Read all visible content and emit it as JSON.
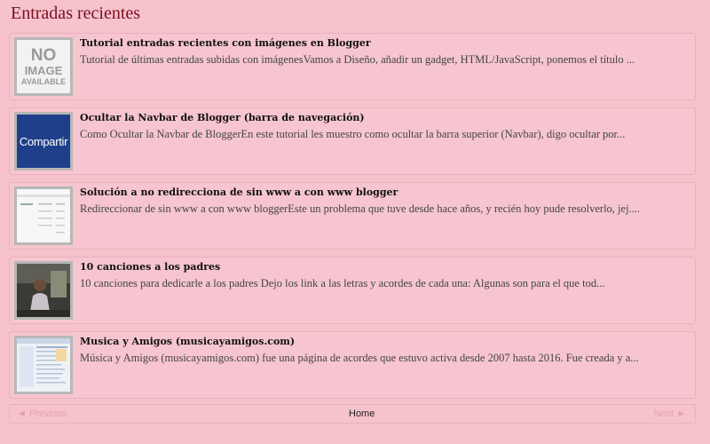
{
  "widget": {
    "title": "Entradas recientes",
    "items": [
      {
        "title": "Tutorial entradas recientes con imágenes en Blogger",
        "snippet": " Tutorial de últimas entradas subidas con imágenesVamos a Diseño, añadir un gadget, HTML/JavaScript, ponemos el título ...",
        "thumb": {
          "type": "no-image",
          "lines": [
            "NO",
            "IMAGE",
            "AVAILABLE"
          ]
        }
      },
      {
        "title": "Ocultar la Navbar de Blogger (barra de navegación)",
        "snippet": "Como Ocultar la Navbar de BloggerEn este tutorial les muestro como ocultar la barra superior (Navbar), digo ocultar por...",
        "thumb": {
          "type": "share",
          "label": "Compartir"
        }
      },
      {
        "title": "Solución a no redirecciona de sin www a con www blogger",
        "snippet": "Redireccionar de sin www a con www bloggerEste un problema que tuve desde hace años, y recién hoy pude resolverlo, jej....",
        "thumb": {
          "type": "screenshot"
        }
      },
      {
        "title": "10 canciones a los padres",
        "snippet": "10 canciones para dedicarle a los padres Dejo los link a las letras y acordes de cada una: Algunas son para el que tod...",
        "thumb": {
          "type": "photo"
        }
      },
      {
        "title": "Musica y Amigos (musicayamigos.com)",
        "snippet": "Música y Amigos (musicayamigos.com) fue una página de acordes que estuvo activa desde 2007 hasta 2016. Fue creada y a...",
        "thumb": {
          "type": "screenshot-page"
        }
      }
    ]
  },
  "pager": {
    "previous": "◄ Previous",
    "home": "Home",
    "next": "Next ►"
  }
}
